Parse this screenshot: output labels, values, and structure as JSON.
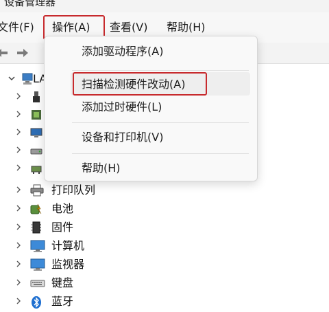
{
  "window": {
    "title": "设备管理器"
  },
  "menubar": {
    "file": "文件(F)",
    "action": "操作(A)",
    "view": "查看(V)",
    "help": "帮助(H)"
  },
  "toolbar": {
    "back_icon": "back-arrow-icon",
    "forward_icon": "forward-arrow-icon"
  },
  "action_menu": {
    "items": [
      {
        "label": "添加驱动程序(A)"
      },
      {
        "label": "扫描检测硬件改动(A)",
        "highlighted": true
      },
      {
        "label": "添加过时硬件(L)"
      },
      {
        "label": "设备和打印机(V)"
      },
      {
        "label": "帮助(H)"
      }
    ]
  },
  "tree": {
    "root": {
      "label": "LA",
      "icon": "computer-icon"
    },
    "nodes": [
      {
        "label": "",
        "icon": "usb-device-icon"
      },
      {
        "label": "",
        "icon": "processor-icon"
      },
      {
        "label": "",
        "icon": "monitor-icon"
      },
      {
        "label": "",
        "icon": "disk-drive-icon"
      },
      {
        "label": "",
        "icon": "network-adapter-icon"
      },
      {
        "label": "打印队列",
        "icon": "printer-icon"
      },
      {
        "label": "电池",
        "icon": "battery-icon"
      },
      {
        "label": "固件",
        "icon": "firmware-icon"
      },
      {
        "label": "计算机",
        "icon": "computer-icon"
      },
      {
        "label": "监视器",
        "icon": "monitor-icon"
      },
      {
        "label": "键盘",
        "icon": "keyboard-icon"
      },
      {
        "label": "蓝牙",
        "icon": "bluetooth-icon"
      }
    ]
  },
  "colors": {
    "highlight_box": "#c72a2d",
    "menu_bg": "#f9f9f9"
  }
}
